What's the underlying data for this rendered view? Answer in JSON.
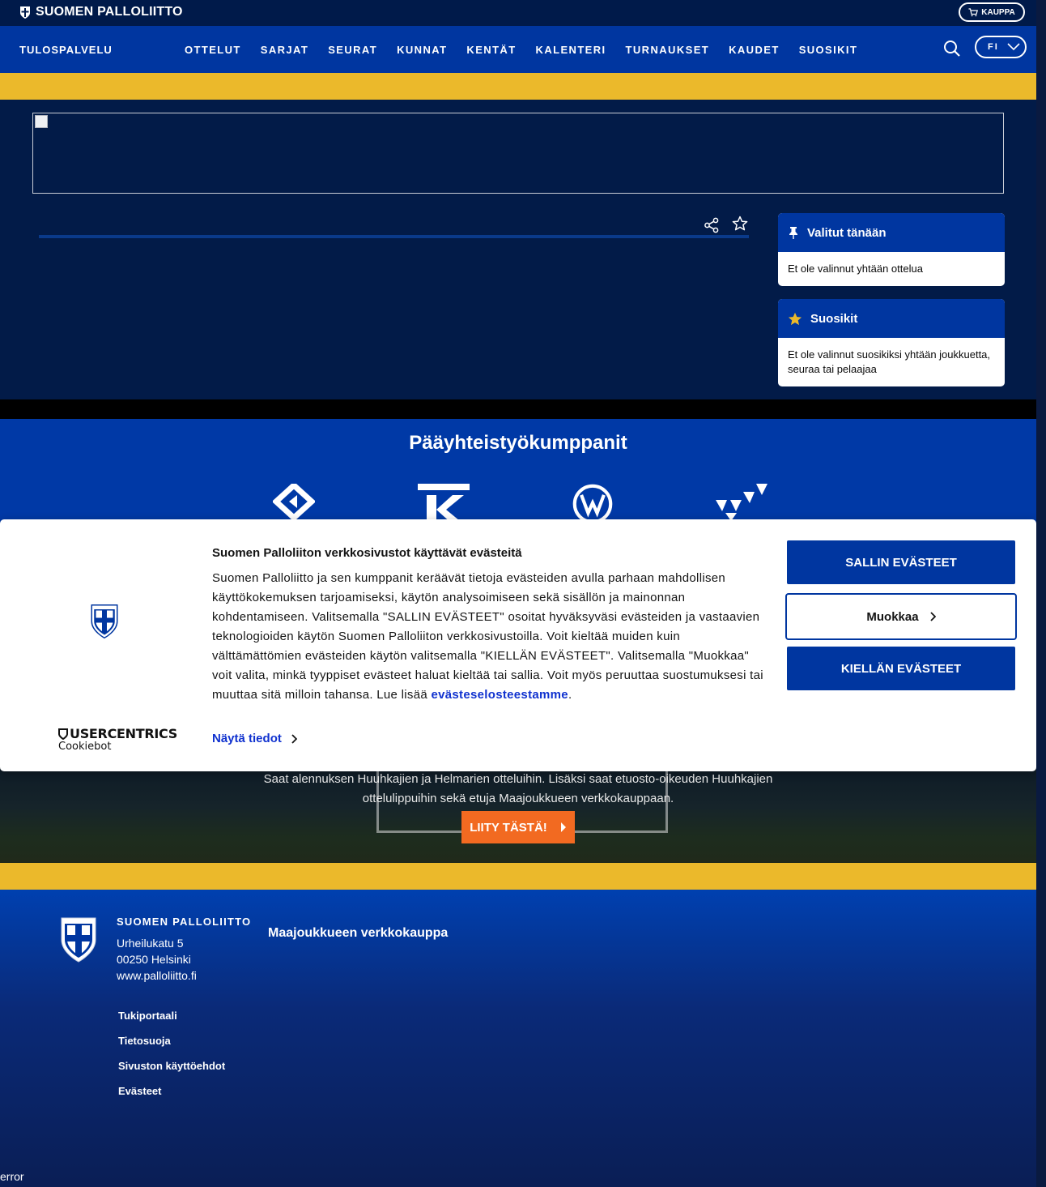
{
  "topbar": {
    "brand": "SUOMEN PALLOLIITTO",
    "shop_label": "KAUPPA"
  },
  "nav": {
    "title": "TULOSPALVELU",
    "items": [
      "OTTELUT",
      "SARJAT",
      "SEURAT",
      "KUNNAT",
      "KENTÄT",
      "KALENTERI",
      "TURNAUKSET",
      "KAUDET",
      "SUOSIKIT"
    ],
    "language": "FI"
  },
  "sidebar": {
    "today": {
      "title": "Valitut tänään",
      "body": "Et ole valinnut yhtään ottelua"
    },
    "favorites": {
      "title": "Suosikit",
      "body": "Et ole valinnut suosikiksi yhtään joukkuetta, seuraa tai pelaajaa"
    }
  },
  "partners": {
    "title": "Pääyhteistyökumppanit"
  },
  "promo": {
    "line1": "Saat alennuksen Huuhkajien ja Helmarien otteluihin. Lisäksi saat etuosto-oikeuden Huuhkajien",
    "line2": "ottelulippuihin sekä etuja Maajoukkueen verkkokauppaan.",
    "button": "LIITY TÄSTÄ!"
  },
  "footer": {
    "org": "SUOMEN PALLOLIITTO",
    "street": "Urheilukatu 5",
    "city": "00250 Helsinki",
    "web": "www.palloliitto.fi",
    "shop": "Maajoukkueen verkkokauppa",
    "links": [
      "Tukiportaali",
      "Tietosuoja",
      "Sivuston käyttöehdot",
      "Evästeet"
    ]
  },
  "cookie": {
    "title": "Suomen Palloliiton verkkosivustot käyttävät evästeitä",
    "body": "Suomen Palloliitto ja sen kumppanit keräävät tietoja evästeiden avulla parhaan mahdollisen käyttökokemuksen tarjoamiseksi, käytön analysoimiseen sekä sisällön ja mainonnan kohdentamiseen. Valitsemalla \"SALLIN EVÄSTEET\" osoitat hyväksyväsi evästeiden ja vastaavien teknologioiden käytön Suomen Palloliiton verkkosivustoilla. Voit kieltää muiden kuin välttämättömien evästeiden käytön valitsemalla \"KIELLÄN EVÄSTEET\". Valitsemalla \"Muokkaa\" voit valita, minkä tyyppiset evästeet haluat kieltää tai sallia. Voit myös peruuttaa suostumuksesi tai muuttaa sitä milloin tahansa. Lue lisää ",
    "link": "evästeselosteestamme",
    "period": ".",
    "details": "Näytä tiedot",
    "allow": "SALLIN EVÄSTEET",
    "edit": "Muokkaa",
    "deny": "KIELLÄN EVÄSTEET",
    "brand_top": "USERCENTRICS",
    "brand_bottom": "Cookiebot"
  },
  "status": {
    "error": "error"
  },
  "colors": {
    "navy": "#021b48",
    "blue": "#0036a0",
    "yellow": "#ebb92b",
    "orange": "#f26a21",
    "link": "#1032cf"
  },
  "icons": [
    "shield-icon",
    "cart-icon",
    "search-icon",
    "chevron-down-icon",
    "share-icon",
    "star-outline-icon",
    "pin-icon",
    "star-icon",
    "chevron-right-icon"
  ]
}
